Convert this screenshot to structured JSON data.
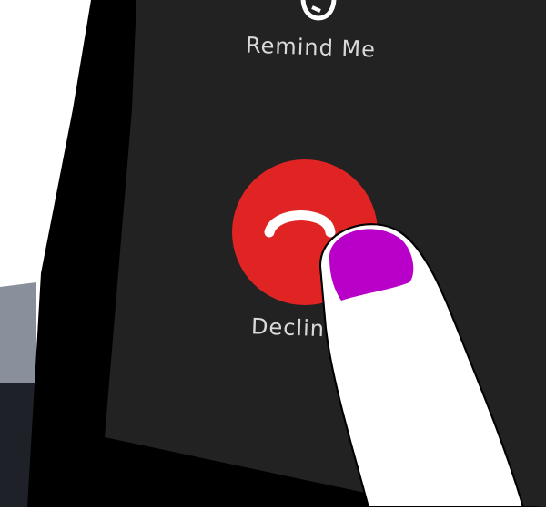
{
  "call_screen": {
    "remind_label": "Remind Me",
    "decline_label": "Decline",
    "remind_icon": "alarm-clock-icon",
    "decline_icon": "phone-hang-up-icon"
  },
  "colors": {
    "phone_screen": "#222222",
    "phone_bezel": "#000000",
    "decline_button": "#e02424",
    "fingertip": "#ffffff",
    "fingernail": "#b800c8"
  }
}
